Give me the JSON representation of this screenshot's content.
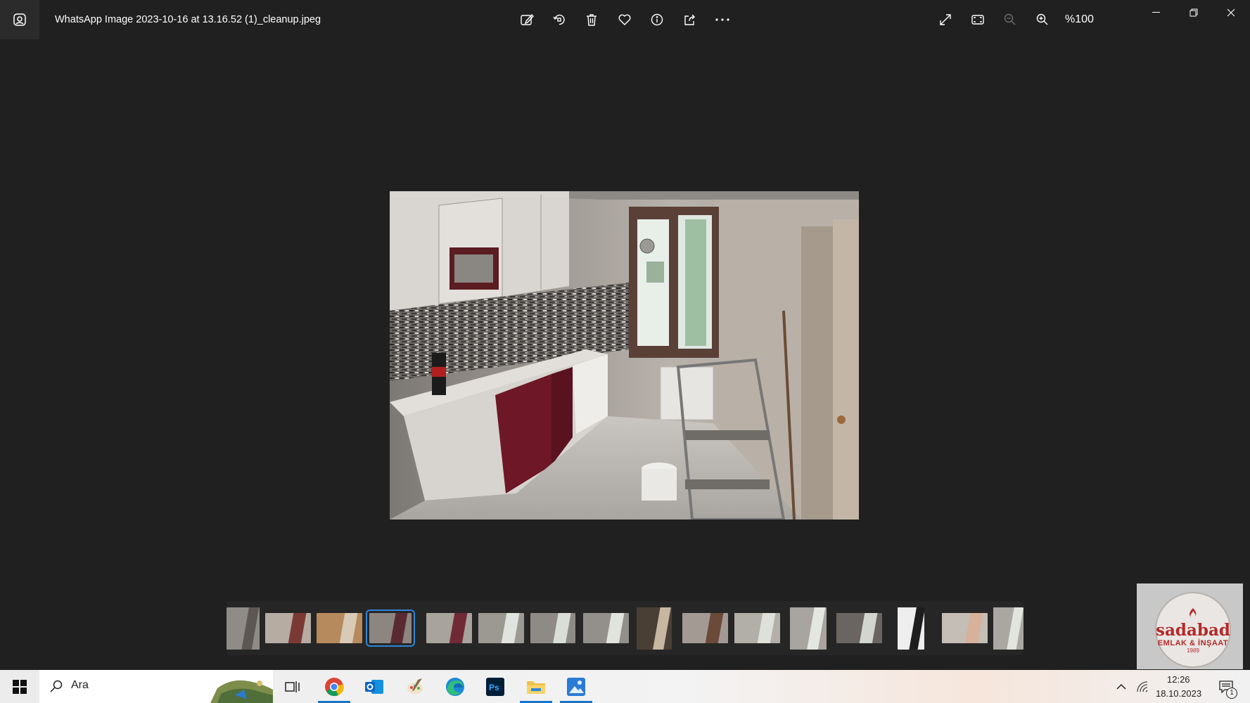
{
  "titlebar": {
    "file_name": "WhatsApp Image 2023-10-16 at 13.16.52 (1)_cleanup.jpeg",
    "zoom_label": "%100",
    "toolbar_icons": [
      "edit-image-icon",
      "rotate-icon",
      "delete-icon",
      "favorite-icon",
      "info-icon",
      "share-icon",
      "more-icon"
    ],
    "view_icons": [
      "fullscreen-icon",
      "fit-to-window-icon",
      "zoom-out-icon",
      "zoom-in-icon"
    ]
  },
  "filmstrip": {
    "count": 16,
    "selected_index": 3
  },
  "watermark": {
    "name": "sadabad",
    "subtitle": "EMLAK & İNŞAAT",
    "year": "1989"
  },
  "taskbar": {
    "search_placeholder": "Ara",
    "apps": [
      "task-view",
      "chrome",
      "outlook",
      "paint",
      "edge",
      "photoshop",
      "file-explorer",
      "photos"
    ],
    "time": "12:26",
    "date": "18.10.2023",
    "notification_count": "1"
  },
  "colors": {
    "background": "#202020",
    "accent": "#2f86d8",
    "cabinet_red": "#6e1726"
  }
}
